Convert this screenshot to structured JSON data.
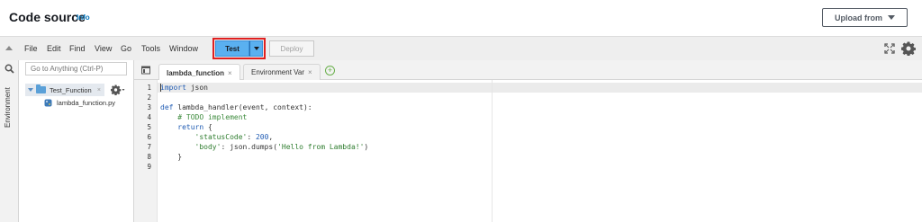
{
  "header": {
    "title": "Code source",
    "info_label": "Info",
    "upload_label": "Upload from"
  },
  "menubar": {
    "items": [
      "File",
      "Edit",
      "Find",
      "View",
      "Go",
      "Tools",
      "Window"
    ],
    "test_label": "Test",
    "deploy_label": "Deploy"
  },
  "sidebar": {
    "env_label": "Environment",
    "goto_placeholder": "Go to Anything (Ctrl-P)",
    "folder_name": "Test_Function",
    "file_name": "lambda_function.py"
  },
  "tabs": [
    {
      "label": "lambda_function",
      "active": true
    },
    {
      "label": "Environment Var",
      "active": false
    }
  ],
  "editor": {
    "line_numbers": [
      "1",
      "2",
      "3",
      "4",
      "5",
      "6",
      "7",
      "8",
      "9"
    ],
    "lines": [
      "import json",
      "",
      "def lambda_handler(event, context):",
      "    # TODO implement",
      "    return {",
      "        'statusCode': 200,",
      "        'body': json.dumps('Hello from Lambda!')",
      "    }",
      ""
    ]
  },
  "colors": {
    "test_button": "#5ab0f0",
    "highlight_frame": "#e02020",
    "link": "#0073bb"
  }
}
